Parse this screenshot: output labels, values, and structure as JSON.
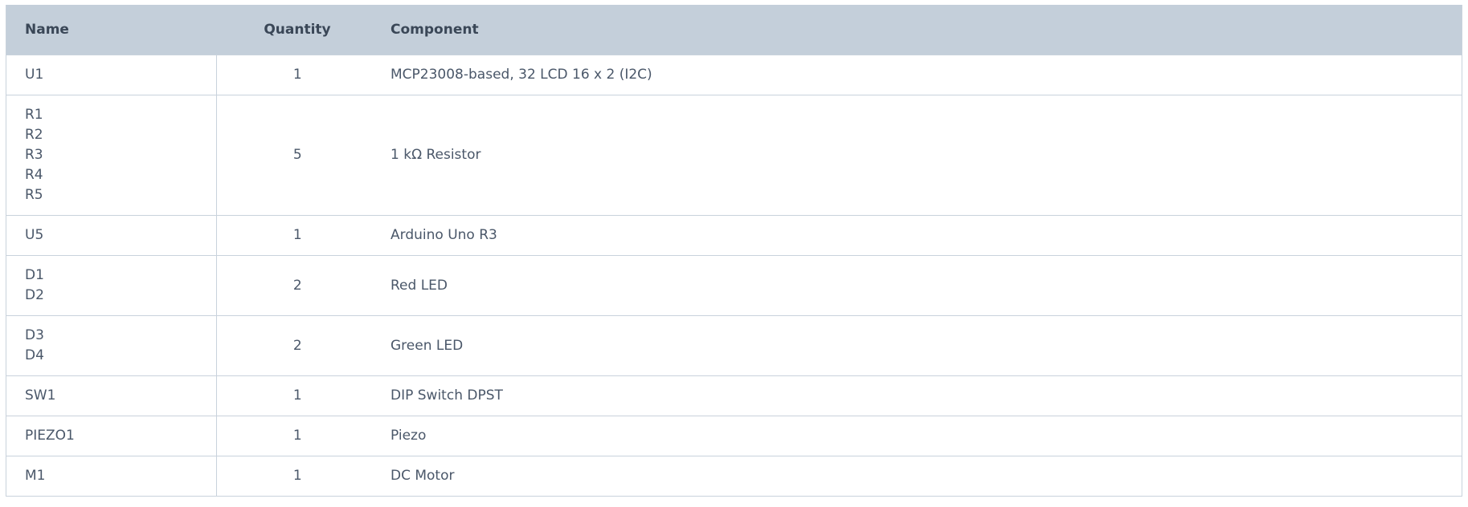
{
  "table": {
    "headers": {
      "name": "Name",
      "quantity": "Quantity",
      "component": "Component"
    },
    "rows": [
      {
        "names": [
          "U1"
        ],
        "quantity": "1",
        "component": "MCP23008-based, 32 LCD 16 x 2 (I2C)"
      },
      {
        "names": [
          "R1",
          "R2",
          "R3",
          "R4",
          "R5"
        ],
        "quantity": "5",
        "component": "1 kΩ Resistor"
      },
      {
        "names": [
          "U5"
        ],
        "quantity": "1",
        "component": "Arduino Uno R3"
      },
      {
        "names": [
          "D1",
          "D2"
        ],
        "quantity": "2",
        "component": "Red LED"
      },
      {
        "names": [
          "D3",
          "D4"
        ],
        "quantity": "2",
        "component": "Green LED"
      },
      {
        "names": [
          "SW1"
        ],
        "quantity": "1",
        "component": "DIP Switch DPST"
      },
      {
        "names": [
          "PIEZO1"
        ],
        "quantity": "1",
        "component": "Piezo"
      },
      {
        "names": [
          "M1"
        ],
        "quantity": "1",
        "component": "DC Motor"
      }
    ]
  }
}
